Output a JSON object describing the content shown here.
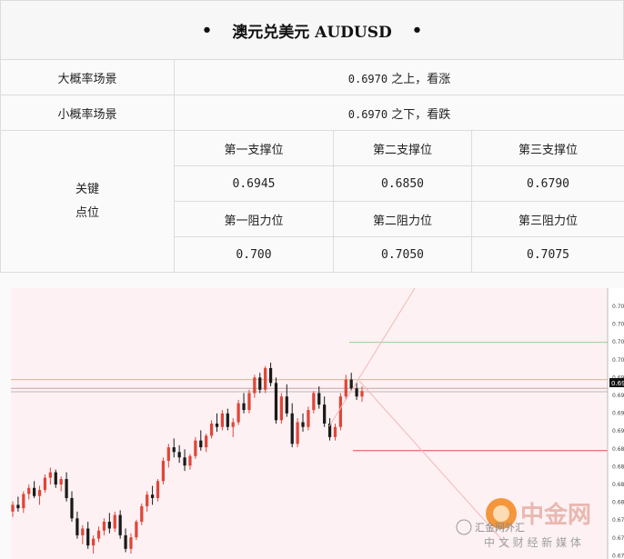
{
  "title": {
    "bullet": "•",
    "text": "澳元兑美元 AUDUSD"
  },
  "scenarios": [
    {
      "label": "大概率场景",
      "level": "0.6970",
      "text": "之上，看涨"
    },
    {
      "label": "小概率场景",
      "level": "0.6970",
      "text": "之下，看跌"
    }
  ],
  "key_levels": {
    "label_line1": "关键",
    "label_line2": "点位",
    "support_headers": [
      "第一支撑位",
      "第二支撑位",
      "第三支撑位"
    ],
    "support_values": [
      "0.6945",
      "0.6850",
      "0.6790"
    ],
    "resistance_headers": [
      "第一阻力位",
      "第二阻力位",
      "第三阻力位"
    ],
    "resistance_values": [
      "0.700",
      "0.7050",
      "0.7075"
    ]
  },
  "watermark": {
    "logo_text": "中金网",
    "subtitle": "中 文 财 经 新 媒 体",
    "handle": "汇金网外汇"
  },
  "chart_data": {
    "type": "candlestick",
    "y_axis_labels": [
      "0.70",
      "0.70",
      "0.70",
      "0.70",
      "0.69",
      "0.69",
      "0.69",
      "0.69",
      "0.68",
      "0.68",
      "0.68",
      "0.68",
      "0.67",
      "0.67",
      "0.67"
    ],
    "current_price_label": "0.69",
    "grid": false,
    "colors": {
      "up": "#e0463a",
      "down": "#1a1a1a",
      "background": "#fdf1f3",
      "resistance_line": "#9cd08a",
      "support_line": "#e05050"
    },
    "candles": [
      [
        0.676,
        0.6775,
        0.6752,
        0.677
      ],
      [
        0.677,
        0.6782,
        0.676,
        0.6765
      ],
      [
        0.6765,
        0.679,
        0.6758,
        0.6786
      ],
      [
        0.6786,
        0.68,
        0.6778,
        0.6795
      ],
      [
        0.6795,
        0.6805,
        0.678,
        0.6783
      ],
      [
        0.6783,
        0.6798,
        0.677,
        0.6792
      ],
      [
        0.6792,
        0.6815,
        0.6788,
        0.681
      ],
      [
        0.681,
        0.6825,
        0.68,
        0.6818
      ],
      [
        0.6818,
        0.6822,
        0.6795,
        0.68
      ],
      [
        0.68,
        0.6812,
        0.679,
        0.6808
      ],
      [
        0.6808,
        0.6818,
        0.6775,
        0.678
      ],
      [
        0.678,
        0.679,
        0.6745,
        0.675
      ],
      [
        0.675,
        0.676,
        0.672,
        0.6725
      ],
      [
        0.6725,
        0.674,
        0.6712,
        0.6735
      ],
      [
        0.6735,
        0.6745,
        0.6705,
        0.671
      ],
      [
        0.671,
        0.6725,
        0.6698,
        0.672
      ],
      [
        0.672,
        0.6738,
        0.6715,
        0.6732
      ],
      [
        0.6732,
        0.675,
        0.6725,
        0.6745
      ],
      [
        0.6745,
        0.6758,
        0.6728,
        0.6735
      ],
      [
        0.6735,
        0.676,
        0.673,
        0.6755
      ],
      [
        0.6755,
        0.6762,
        0.672,
        0.6725
      ],
      [
        0.6725,
        0.6735,
        0.67,
        0.6705
      ],
      [
        0.6705,
        0.6728,
        0.6698,
        0.6722
      ],
      [
        0.6722,
        0.6748,
        0.6718,
        0.6745
      ],
      [
        0.6745,
        0.6772,
        0.674,
        0.6768
      ],
      [
        0.6768,
        0.679,
        0.676,
        0.6785
      ],
      [
        0.6785,
        0.6798,
        0.677,
        0.678
      ],
      [
        0.678,
        0.6808,
        0.6775,
        0.6805
      ],
      [
        0.6805,
        0.684,
        0.68,
        0.6835
      ],
      [
        0.6835,
        0.686,
        0.6825,
        0.6855
      ],
      [
        0.6855,
        0.6868,
        0.684,
        0.6848
      ],
      [
        0.6848,
        0.6858,
        0.6832,
        0.684
      ],
      [
        0.684,
        0.6852,
        0.682,
        0.6828
      ],
      [
        0.6828,
        0.6845,
        0.6822,
        0.6842
      ],
      [
        0.6842,
        0.687,
        0.6838,
        0.6865
      ],
      [
        0.6865,
        0.688,
        0.685,
        0.6855
      ],
      [
        0.6855,
        0.6875,
        0.6848,
        0.6872
      ],
      [
        0.6872,
        0.6895,
        0.6868,
        0.689
      ],
      [
        0.689,
        0.6905,
        0.6878,
        0.6885
      ],
      [
        0.6885,
        0.691,
        0.688,
        0.6905
      ],
      [
        0.6905,
        0.6912,
        0.688,
        0.6885
      ],
      [
        0.6885,
        0.6898,
        0.687,
        0.6892
      ],
      [
        0.6892,
        0.6925,
        0.6888,
        0.692
      ],
      [
        0.692,
        0.6935,
        0.6905,
        0.691
      ],
      [
        0.691,
        0.694,
        0.6905,
        0.6935
      ],
      [
        0.6935,
        0.6962,
        0.6928,
        0.6958
      ],
      [
        0.6958,
        0.6965,
        0.6935,
        0.694
      ],
      [
        0.694,
        0.6975,
        0.6935,
        0.6972
      ],
      [
        0.6972,
        0.698,
        0.6945,
        0.695
      ],
      [
        0.695,
        0.6958,
        0.689,
        0.6895
      ],
      [
        0.6895,
        0.6935,
        0.689,
        0.693
      ],
      [
        0.693,
        0.6948,
        0.69,
        0.6905
      ],
      [
        0.6905,
        0.692,
        0.6855,
        0.686
      ],
      [
        0.686,
        0.6898,
        0.6855,
        0.6892
      ],
      [
        0.6892,
        0.6905,
        0.6878,
        0.6885
      ],
      [
        0.6885,
        0.6915,
        0.688,
        0.691
      ],
      [
        0.691,
        0.6938,
        0.6905,
        0.6935
      ],
      [
        0.6935,
        0.6945,
        0.6912,
        0.6918
      ],
      [
        0.6918,
        0.693,
        0.6885,
        0.689
      ],
      [
        0.689,
        0.6898,
        0.6865,
        0.687
      ],
      [
        0.687,
        0.689,
        0.6865,
        0.6885
      ],
      [
        0.6885,
        0.6935,
        0.688,
        0.693
      ],
      [
        0.693,
        0.6962,
        0.6925,
        0.6955
      ],
      [
        0.6955,
        0.6965,
        0.6938,
        0.6942
      ],
      [
        0.6942,
        0.695,
        0.6925,
        0.693
      ],
      [
        0.693,
        0.6945,
        0.6922,
        0.6938
      ]
    ],
    "lines": [
      {
        "name": "resistance",
        "price": 0.701,
        "color": "#9cd08a"
      },
      {
        "name": "level",
        "price": 0.6955,
        "color": "#d7b59a"
      },
      {
        "name": "level",
        "price": 0.6942,
        "color": "#c7a3a3"
      },
      {
        "name": "level",
        "price": 0.6937,
        "color": "#b9b9b9"
      },
      {
        "name": "support",
        "price": 0.685,
        "color": "#e05050"
      }
    ]
  }
}
